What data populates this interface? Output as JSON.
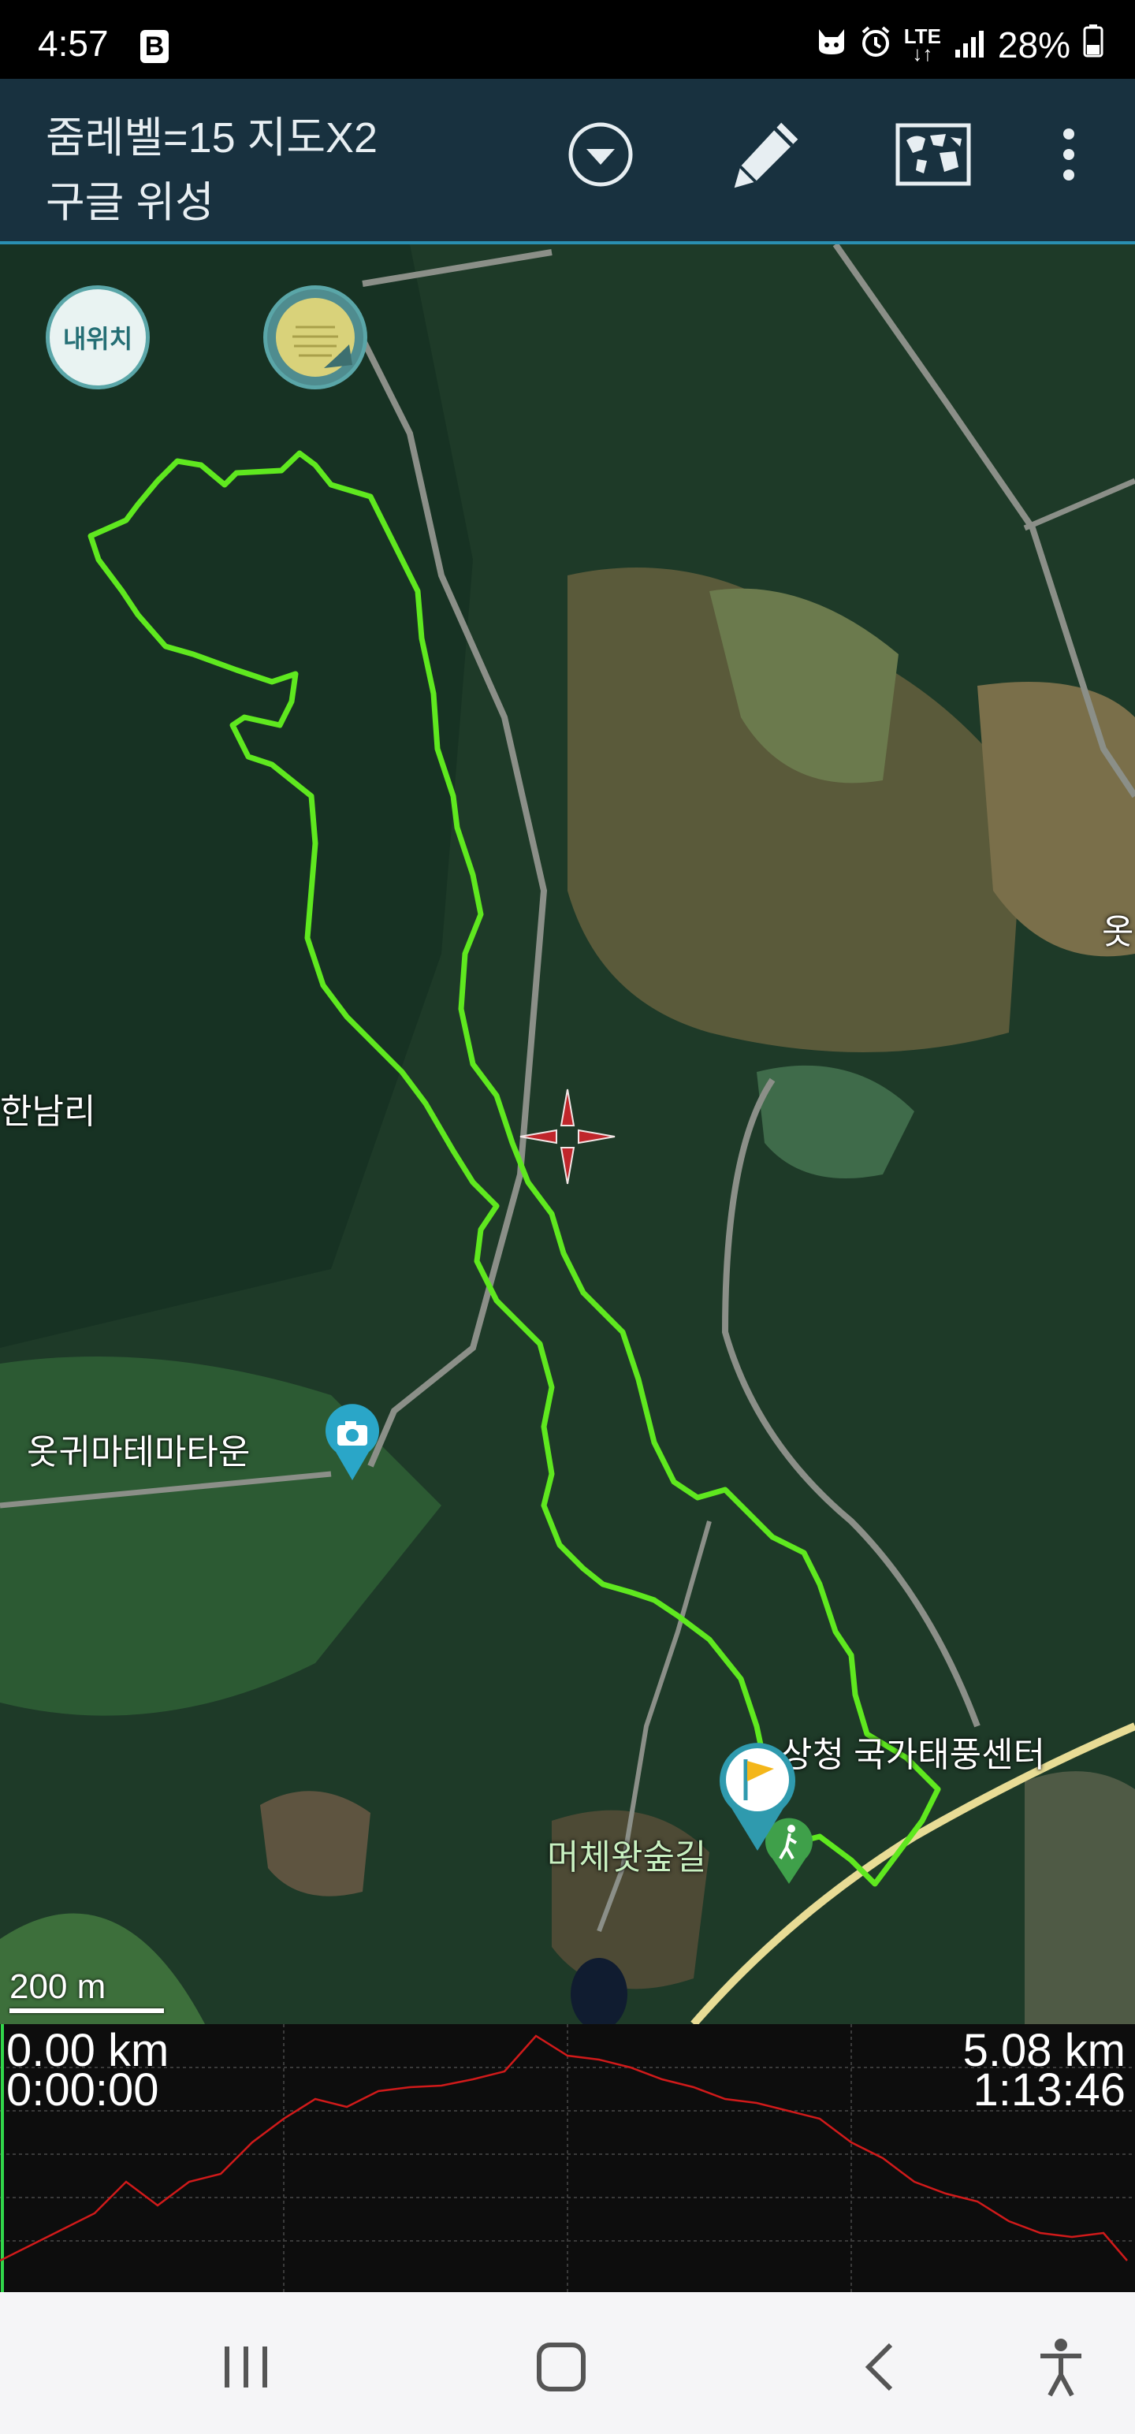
{
  "status_bar": {
    "time": "4:57",
    "carrier_badge": "B",
    "network": "LTE",
    "battery": "28%",
    "icons": [
      "cat-icon",
      "alarm-icon",
      "lte-icon",
      "signal-icon",
      "battery-icon"
    ]
  },
  "app_bar": {
    "title_line1": "줌레벨=15 지도X2",
    "title_line2": "구글 위성",
    "actions": [
      "dropdown-icon",
      "pencil-icon",
      "world-map-icon",
      "more-vert-icon"
    ]
  },
  "map": {
    "my_location_label": "내위치",
    "place_labels": {
      "hannam": "한남리",
      "town": "옷귀마테마타운",
      "typhoon_center": "상청 국가태풍센터",
      "forest_trail": "머체왓숲길",
      "edge_partial": "옷"
    },
    "scale_label": "200 m",
    "track_color": "#5fe81f",
    "crosshair_color": "#c0262b"
  },
  "elevation_profile": {
    "start_distance": "0.00 km",
    "start_time": "0:00:00",
    "end_distance": "5.08 km",
    "end_time": "1:13:46",
    "line_color": "#d01a1a"
  },
  "nav_bar": {
    "buttons": [
      "recent-apps-icon",
      "home-icon",
      "back-icon",
      "accessibility-icon"
    ]
  }
}
